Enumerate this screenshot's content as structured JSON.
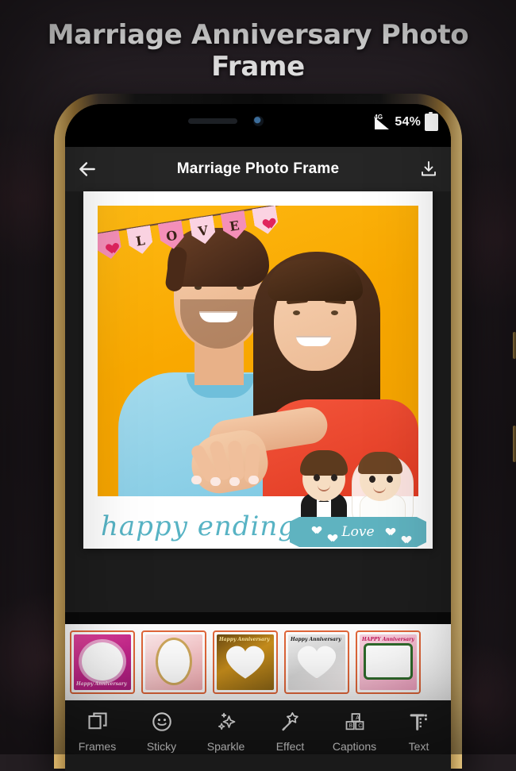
{
  "poster": {
    "title": "Marriage Anniversary Photo Frame"
  },
  "statusbar": {
    "network": "4G",
    "battery_percent": "54%",
    "signal_icon": "signal-bars-icon",
    "battery_icon": "battery-icon"
  },
  "appbar": {
    "title": "Marriage Photo Frame",
    "back_icon": "back-arrow-icon",
    "download_icon": "download-icon"
  },
  "canvas": {
    "banner_letters": [
      "L",
      "O",
      "V",
      "E"
    ],
    "banner_heart_icon": "heart-icon",
    "caption": "happy ending",
    "ribbon_text": "Love",
    "sticker_name": "bride-and-groom-sticker",
    "photo_alt": "couple-photo"
  },
  "thumbnails": [
    {
      "name": "frame-balloons-cake",
      "label": "Happy Anniversary"
    },
    {
      "name": "frame-gift-ribbon-oval",
      "label": ""
    },
    {
      "name": "frame-gold-bokeh-heart",
      "label": "Happy Anniversary"
    },
    {
      "name": "frame-red-roses-heart",
      "label": "Happy Anniversary"
    },
    {
      "name": "frame-pink-roses-border",
      "label": "HAPPY Anniversary"
    }
  ],
  "toolbar": [
    {
      "label": "Frames",
      "icon": "layers-icon"
    },
    {
      "label": "Sticky",
      "icon": "smiley-icon"
    },
    {
      "label": "Sparkle",
      "icon": "sparkles-icon"
    },
    {
      "label": "Effect",
      "icon": "magic-wand-icon"
    },
    {
      "label": "Captions",
      "icon": "abc-blocks-icon"
    },
    {
      "label": "Text",
      "icon": "text-tool-icon"
    }
  ],
  "colors": {
    "accent": "#e2673a",
    "photo_bg": "#fdb913",
    "caption": "#57b3c4",
    "appbar_bg": "#262626"
  }
}
